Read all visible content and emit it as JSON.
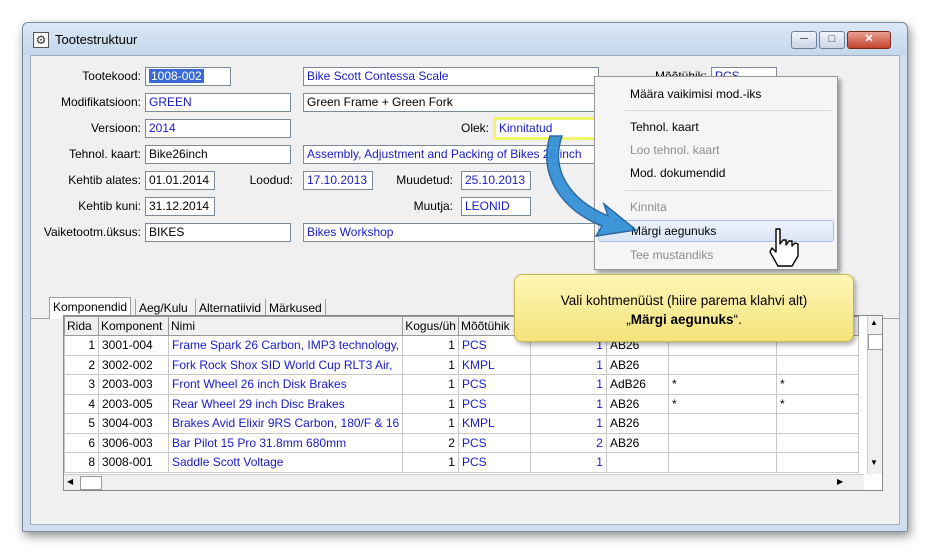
{
  "window": {
    "title": "Tootestruktuur",
    "min": "─",
    "max": "□",
    "close": "✕"
  },
  "form": {
    "tootekood": {
      "label": "Tootekood:",
      "value": "1008-002",
      "name": "Bike Scott Contessa Scale"
    },
    "modifikatsioon": {
      "label": "Modifikatsioon:",
      "value": "GREEN",
      "name": "Green Frame + Green Fork"
    },
    "versioon": {
      "label": "Versioon:",
      "value": "2014"
    },
    "olek": {
      "label": "Olek:",
      "value": "Kinnitatud"
    },
    "tehnol_kaart": {
      "label": "Tehnol. kaart:",
      "value": "Bike26inch",
      "name": "Assembly, Adjustment and Packing of Bikes 26 inch"
    },
    "kehtib_alates": {
      "label": "Kehtib alates:",
      "value": "01.01.2014"
    },
    "loodud": {
      "label": "Loodud:",
      "value": "17.10.2013"
    },
    "muudetud": {
      "label": "Muudetud:",
      "value": "25.10.2013"
    },
    "kehtib_kuni": {
      "label": "Kehtib kuni:",
      "value": "31.12.2014"
    },
    "muutja": {
      "label": "Muutja:",
      "value": "LEONID"
    },
    "vaiketootm": {
      "label": "Vaiketootm.üksus:",
      "value": "BIKES",
      "name": "Bikes Workshop"
    },
    "mootuhik": {
      "label": "Mõõtühik:",
      "value": "PCS"
    }
  },
  "tabs": [
    "Komponendid",
    "Aeg/Kulu",
    "Alternatiivid",
    "Märkused"
  ],
  "grid": {
    "headers": [
      "Rida",
      "Komponent",
      "Nimi",
      "Kogus/üh",
      "Mõõtühik",
      "",
      "",
      "",
      ""
    ],
    "rows": [
      [
        "1",
        "3001-004",
        "Frame Spark 26 Carbon, IMP3 technology,",
        "1",
        "PCS",
        "1",
        "AB26",
        "",
        ""
      ],
      [
        "2",
        "3002-002",
        "Fork Rock Shox SID World Cup RLT3 Air,",
        "1",
        "KMPL",
        "1",
        "AB26",
        "",
        ""
      ],
      [
        "3",
        "2003-003",
        "Front Wheel 26 inch Disk Brakes",
        "1",
        "PCS",
        "1",
        "AdB26",
        "*",
        "*"
      ],
      [
        "4",
        "2003-005",
        "Rear Wheel 29 inch Disc Brakes",
        "1",
        "PCS",
        "1",
        "AB26",
        "*",
        "*"
      ],
      [
        "5",
        "3004-003",
        "Brakes Avid Elixir 9RS Carbon, 180/F & 16",
        "1",
        "KMPL",
        "1",
        "AB26",
        "",
        ""
      ],
      [
        "6",
        "3006-003",
        "Bar Pilot 15 Pro 31.8mm 680mm",
        "2",
        "PCS",
        "2",
        "AB26",
        "",
        ""
      ],
      [
        "8",
        "3008-001",
        "Saddle Scott Voltage",
        "1",
        "PCS",
        "1",
        "",
        "",
        ""
      ]
    ]
  },
  "context_menu": {
    "items": [
      {
        "label": "Määra vaikimisi mod.-iks",
        "disabled": false
      },
      {
        "label": "Tehnol. kaart",
        "disabled": false
      },
      {
        "label": "Loo tehnol. kaart",
        "disabled": true
      },
      {
        "label": "Mod. dokumendid",
        "disabled": false
      },
      {
        "label": "Kinnita",
        "disabled": true
      },
      {
        "label": "Märgi aegunuks",
        "disabled": false,
        "highlighted": true
      },
      {
        "label": "Tee mustandiks",
        "disabled": true
      }
    ]
  },
  "callout": {
    "line1": "Vali kohtmenüüst (hiire parema klahvi alt)",
    "quote_open": "„",
    "bold": "Märgi aegunuks",
    "quote_close": "“."
  },
  "colors": {
    "link_blue": "#1a1acc",
    "selection": "#3a6ad4",
    "callout_fill": "#f8ea8e",
    "arrow_blue": "#2f8fd6"
  },
  "icons": [
    "app-icon",
    "hand-cursor-icon",
    "arrow-icon"
  ]
}
